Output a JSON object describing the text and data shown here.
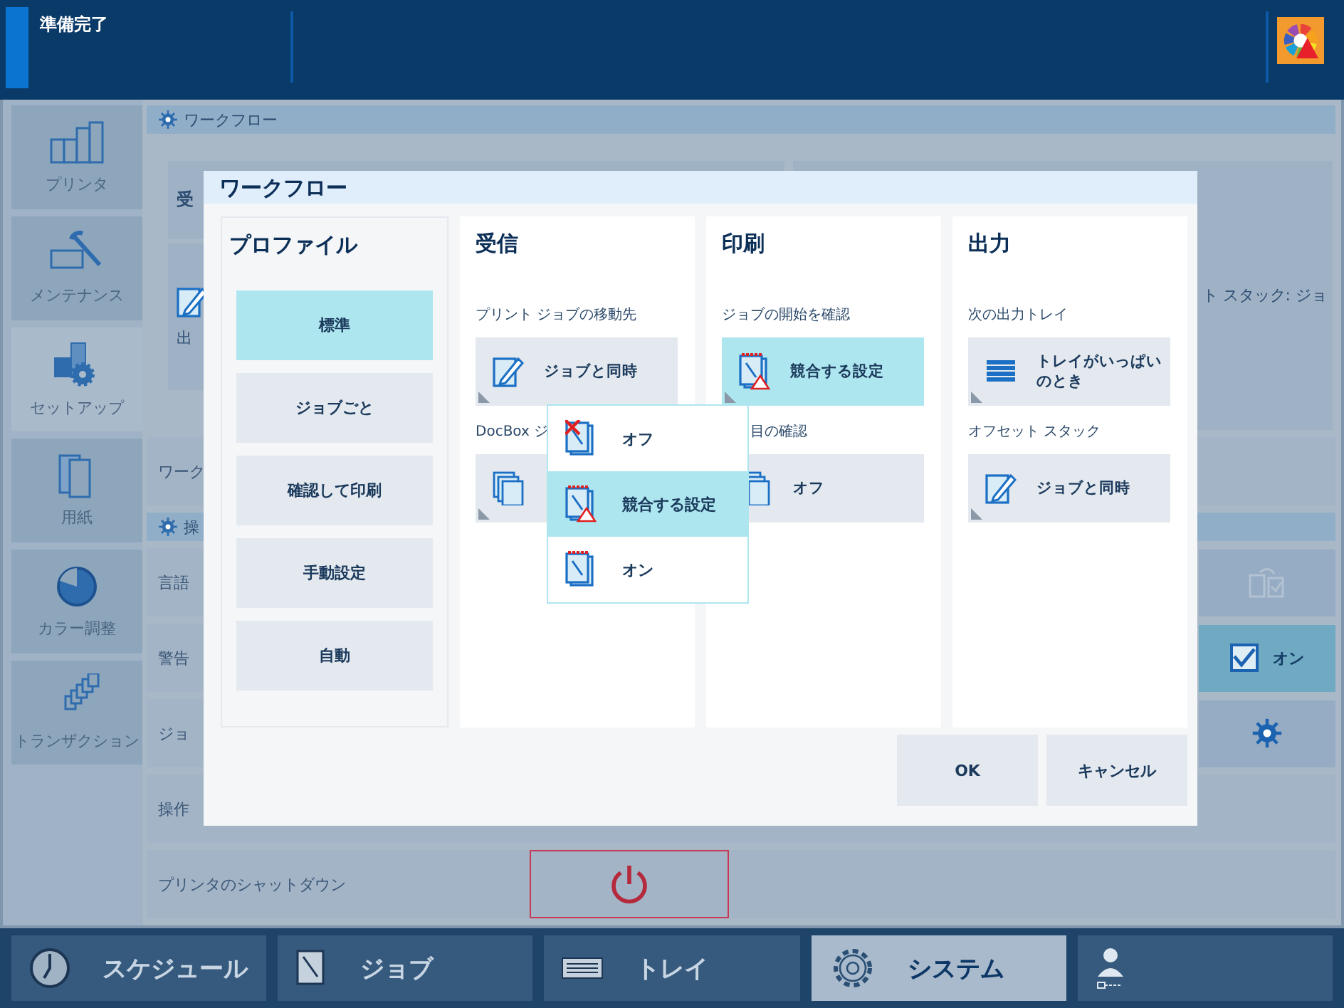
{
  "status_bar": {
    "text": "準備完了",
    "alert": true
  },
  "sidebar": {
    "items": [
      {
        "label": "プリンタ",
        "selected": false
      },
      {
        "label": "メンテナンス",
        "selected": false
      },
      {
        "label": "セットアップ",
        "selected": true
      },
      {
        "label": "用紙",
        "selected": false
      },
      {
        "label": "カラー調整",
        "selected": false
      },
      {
        "label": "トランザクション",
        "selected": false
      }
    ]
  },
  "background": {
    "section_header": "ワークフロー",
    "tiles": [
      "受",
      "出",
      "ト スタック: ジョ"
    ],
    "row_label": "ワーク",
    "section2_header": "操",
    "rows": [
      {
        "label": "言語",
        "kind": "icon"
      },
      {
        "label": "警告",
        "kind": "check",
        "value": "オン",
        "checked": true
      },
      {
        "label": "ジョ",
        "kind": "gear"
      },
      {
        "label": "操作",
        "kind": "none"
      },
      {
        "label": "プリンタのシャットダウン",
        "kind": "power"
      }
    ]
  },
  "dialog": {
    "title": "ワークフロー",
    "profiles": {
      "heading": "プロファイル",
      "items": [
        {
          "label": "標準",
          "selected": true
        },
        {
          "label": "ジョブごと",
          "selected": false
        },
        {
          "label": "確認して印刷",
          "selected": false
        },
        {
          "label": "手動設定",
          "selected": false
        },
        {
          "label": "自動",
          "selected": false
        }
      ]
    },
    "columns": [
      {
        "heading": "受信",
        "settings": [
          {
            "label": "プリント ジョブの移動先",
            "value": "ジョブと同時",
            "selected": false
          },
          {
            "label": "DocBox ジ",
            "selected": false
          }
        ]
      },
      {
        "heading": "印刷",
        "settings": [
          {
            "label": "ジョブの開始を確認",
            "value": "競合する設定",
            "selected": true
          },
          {
            "label": "目の確認",
            "value": "オフ",
            "selected": false
          }
        ]
      },
      {
        "heading": "出力",
        "settings": [
          {
            "label": "次の出力トレイ",
            "value": "トレイがいっぱいのとき",
            "selected": false
          },
          {
            "label": "オフセット スタック",
            "value": "ジョブと同時",
            "selected": false
          }
        ]
      }
    ],
    "popup": {
      "items": [
        {
          "label": "オフ",
          "selected": false
        },
        {
          "label": "競合する設定",
          "selected": true
        },
        {
          "label": "オン",
          "selected": false
        }
      ]
    },
    "buttons": [
      "OK",
      "キャンセル"
    ]
  },
  "bottom_nav": {
    "tabs": [
      {
        "label": "スケジュール",
        "selected": false
      },
      {
        "label": "ジョブ",
        "selected": false
      },
      {
        "label": "トレイ",
        "selected": false
      },
      {
        "label": "システム",
        "selected": true
      },
      {
        "selected": false
      }
    ]
  }
}
